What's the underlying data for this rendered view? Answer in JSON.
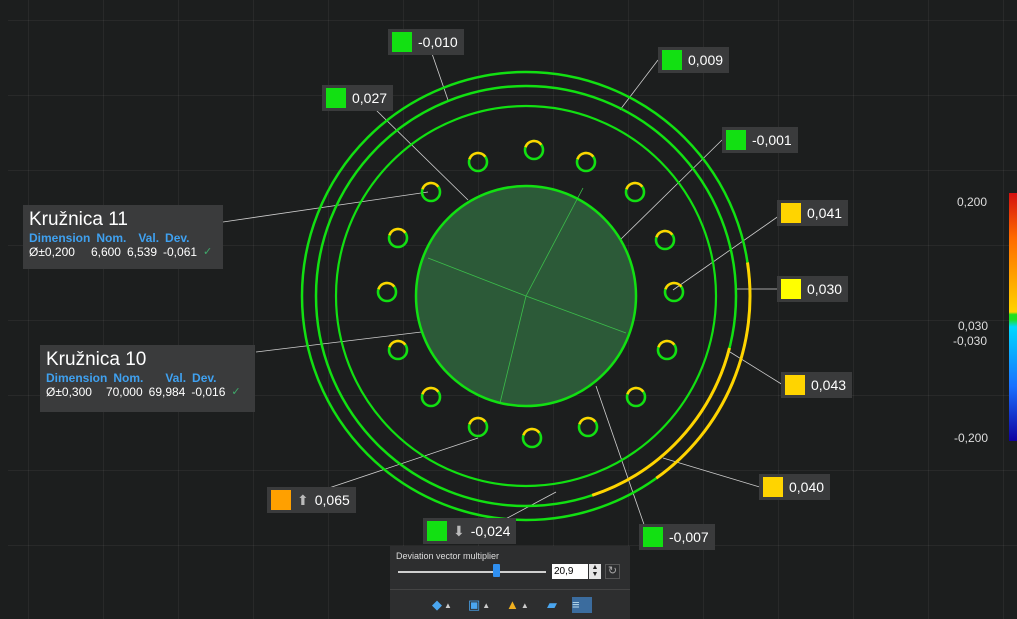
{
  "callouts": [
    {
      "id": "c1",
      "value": "-0,010",
      "color": "#12e012"
    },
    {
      "id": "c2",
      "value": "0,009",
      "color": "#12e012"
    },
    {
      "id": "c3",
      "value": "0,027",
      "color": "#12e012"
    },
    {
      "id": "c4",
      "value": "-0,001",
      "color": "#12e012"
    },
    {
      "id": "c5",
      "value": "0,041",
      "color": "#ffd400"
    },
    {
      "id": "c6",
      "value": "0,030",
      "color": "#ffff00"
    },
    {
      "id": "c7",
      "value": "0,043",
      "color": "#ffd400"
    },
    {
      "id": "c8",
      "value": "0,040",
      "color": "#ffd400"
    },
    {
      "id": "c9",
      "value": "-0,007",
      "color": "#12e012"
    },
    {
      "id": "c10",
      "value": "-0,024",
      "color": "#12e012",
      "arrow": "down-arrow-icon"
    },
    {
      "id": "c11",
      "value": "0,065",
      "color": "#ffa000",
      "arrow": "up-arrow-icon"
    }
  ],
  "dimensions": [
    {
      "title": "Kružnica 11",
      "headers": [
        "Dimension",
        "Nom.",
        "Val.",
        "Dev."
      ],
      "tolerance": "Ø±0,200",
      "nominal": "6,600",
      "value": "6,539",
      "deviation": "-0,061"
    },
    {
      "title": "Kružnica 10",
      "headers": [
        "Dimension",
        "Nom.",
        "Val.",
        "Dev."
      ],
      "tolerance": "Ø±0,300",
      "nominal": "70,000",
      "value": "69,984",
      "deviation": "-0,016"
    }
  ],
  "legend": {
    "max": "0,200",
    "upper_tol": "0,030",
    "lower_tol": "-0,030",
    "min": "-0,200"
  },
  "panel": {
    "label": "Deviation vector multiplier",
    "multiplier_value": "20,9",
    "slider_fraction": 0.66
  },
  "toolbar": [
    "shape-tool-icon",
    "cube-view-icon",
    "color-shapes-icon",
    "plane-icon",
    "deviation-view-icon"
  ],
  "colors": {
    "in_tolerance": "#12e012",
    "warning": "#ffd400",
    "out_high": "#ffa000",
    "background": "#1c1e1e"
  }
}
